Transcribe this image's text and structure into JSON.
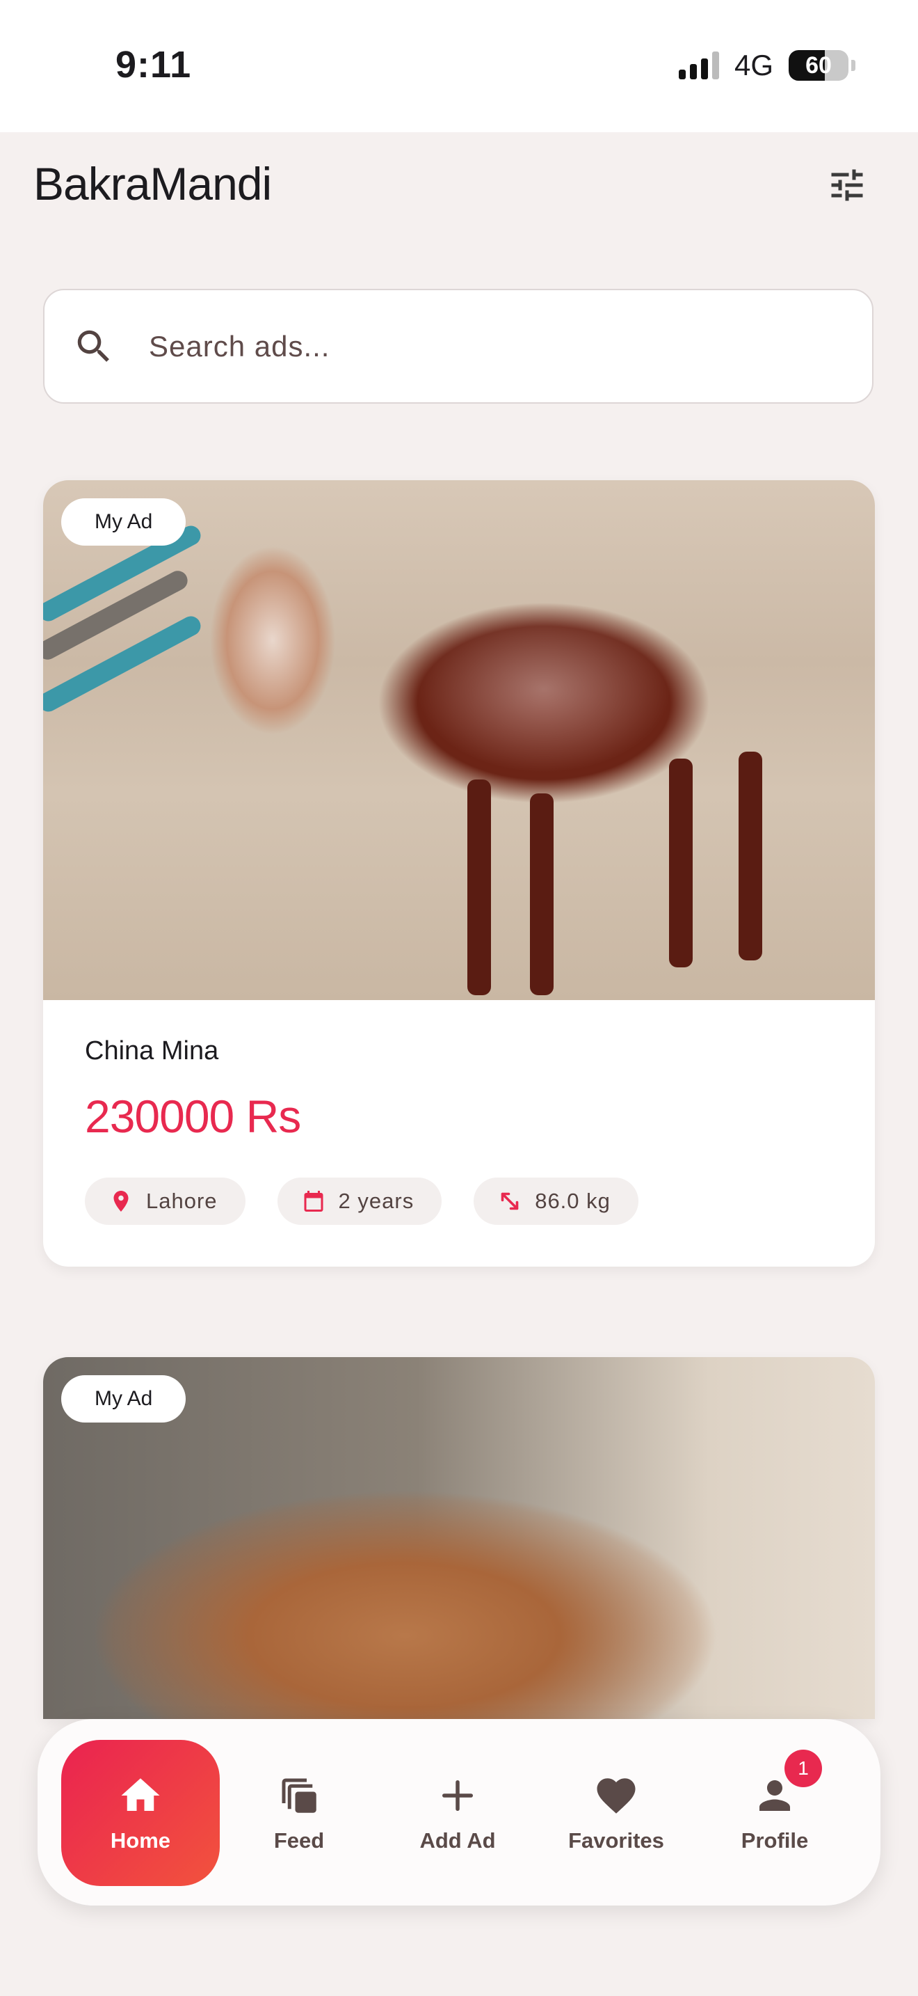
{
  "status_bar": {
    "time": "9:11",
    "network": "4G",
    "battery": "60",
    "battery_level": 0.6
  },
  "header": {
    "title": "BakraMandi",
    "filter_icon": "tune-icon"
  },
  "search": {
    "placeholder": "Search ads...",
    "value": "",
    "icon": "search-icon"
  },
  "ads": [
    {
      "badge": "My Ad",
      "title": "China Mina",
      "price": "230000 Rs",
      "location": "Lahore",
      "age": "2 years",
      "weight": "86.0 kg"
    },
    {
      "badge": "My Ad"
    }
  ],
  "nav": {
    "items": [
      {
        "label": "Home",
        "icon": "home-icon",
        "active": true
      },
      {
        "label": "Feed",
        "icon": "feed-icon"
      },
      {
        "label": "Add Ad",
        "icon": "add-icon"
      },
      {
        "label": "Favorites",
        "icon": "heart-icon"
      },
      {
        "label": "Profile",
        "icon": "profile-icon",
        "badge": "1"
      }
    ]
  },
  "colors": {
    "accent": "#e8294f",
    "accent_gradient_end": "#f2533d",
    "background": "#f5f0ef"
  }
}
